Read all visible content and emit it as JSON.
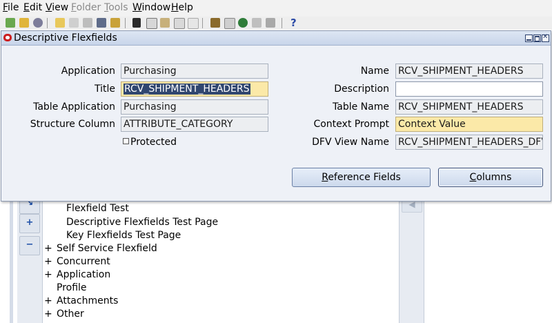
{
  "menu": {
    "items": [
      {
        "label": "File",
        "mnemonic": "F",
        "rest": "ile",
        "enabled": true
      },
      {
        "label": "Edit",
        "mnemonic": "E",
        "rest": "dit",
        "enabled": true
      },
      {
        "label": "View",
        "mnemonic": "V",
        "rest": "iew",
        "enabled": true
      },
      {
        "label": "Folder",
        "mnemonic": "F",
        "rest": "older",
        "enabled": false
      },
      {
        "label": "Tools",
        "mnemonic": "T",
        "rest": "ools",
        "enabled": false
      },
      {
        "label": "Window",
        "mnemonic": "W",
        "rest": "indow",
        "enabled": true
      },
      {
        "label": "Help",
        "mnemonic": "H",
        "rest": "elp",
        "enabled": true
      }
    ]
  },
  "toolbar": {
    "help_glyph": "?",
    "icons": [
      "new-icon",
      "find-icon",
      "show-navigator-icon",
      "save-icon",
      "next-step-icon",
      "print-icon",
      "close-form-icon",
      "cut-icon",
      "copy-icon",
      "paste-icon",
      "new-record-icon",
      "delete-record-icon",
      "edit-field-icon",
      "zoom-icon",
      "translations-icon",
      "attachments-icon",
      "folder-tools-icon",
      "help-icon"
    ]
  },
  "dialog": {
    "title": "Descriptive Flexfields",
    "left": {
      "application_label": "Application",
      "application_value": "Purchasing",
      "title_label": "Title",
      "title_value": "RCV_SHIPMENT_HEADERS",
      "table_application_label": "Table Application",
      "table_application_value": "Purchasing",
      "structure_column_label": "Structure Column",
      "structure_column_value": "ATTRIBUTE_CATEGORY",
      "protected_label": "Protected",
      "protected_checked": false
    },
    "right": {
      "name_label": "Name",
      "name_value": "RCV_SHIPMENT_HEADERS",
      "description_label": "Description",
      "description_value": "",
      "table_name_label": "Table Name",
      "table_name_value": "RCV_SHIPMENT_HEADERS",
      "context_prompt_label": "Context Prompt",
      "context_prompt_value": "Context Value",
      "dfv_view_name_label": "DFV View Name",
      "dfv_view_name_value": "RCV_SHIPMENT_HEADERS_DFV"
    },
    "buttons": {
      "reference_fields": {
        "mnemonic": "R",
        "rest": "eference Fields"
      },
      "columns": {
        "mnemonic": "C",
        "rest": "olumns"
      }
    }
  },
  "navigator": {
    "tree": [
      {
        "label": "Flexfield Test",
        "expander": ""
      },
      {
        "label": "Descriptive Flexfields Test Page",
        "expander": ""
      },
      {
        "label": "Key Flexfields Test Page",
        "expander": ""
      },
      {
        "label": "Self Service Flexfield",
        "expander": "+"
      },
      {
        "label": "Concurrent",
        "expander": "+"
      },
      {
        "label": "Application",
        "expander": "+"
      },
      {
        "label": "Profile",
        "expander": ""
      },
      {
        "label": "Attachments",
        "expander": "+"
      },
      {
        "label": "Other",
        "expander": "+"
      }
    ],
    "side_buttons": [
      "expand-branch-icon",
      "expand-all-icon",
      "collapse-all-icon"
    ]
  },
  "colors": {
    "required_field": "#fbe9a8",
    "selection": "#30466f",
    "window_bg": "#eef1f7",
    "title_bar": "#c8d5ea"
  }
}
